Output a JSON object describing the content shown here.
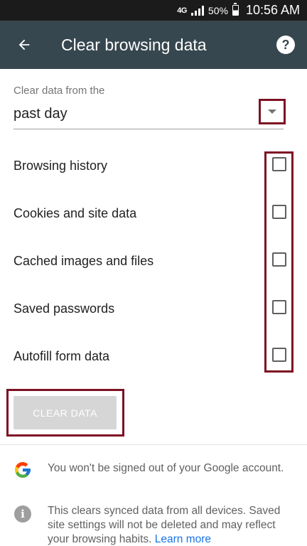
{
  "status_bar": {
    "network": "4G",
    "battery_percent": "50%",
    "time": "10:56 AM"
  },
  "app_bar": {
    "title": "Clear browsing data",
    "back_icon": "arrow-left-icon",
    "help_icon": "help-circle-icon",
    "help_glyph": "?"
  },
  "time_range": {
    "label": "Clear data from the",
    "value": "past day"
  },
  "options": [
    {
      "label": "Browsing history",
      "checked": false
    },
    {
      "label": "Cookies and site data",
      "checked": false
    },
    {
      "label": "Cached images and files",
      "checked": false
    },
    {
      "label": "Saved passwords",
      "checked": false
    },
    {
      "label": "Autofill form data",
      "checked": false
    }
  ],
  "clear_button": {
    "label": "CLEAR DATA",
    "enabled": false
  },
  "notes": {
    "google": {
      "icon": "google-logo-icon",
      "text": "You won't be signed out of your Google account."
    },
    "sync": {
      "icon": "info-icon",
      "glyph": "i",
      "text": "This clears synced data from all devices. Saved site settings will not be deleted and may reflect your browsing habits.",
      "link": "Learn more"
    }
  },
  "colors": {
    "status_bar": "#1b1b1b",
    "app_bar": "#37474f",
    "highlight": "#7d1123",
    "link": "#1a73e8",
    "disabled_button": "#d6d6d6"
  }
}
